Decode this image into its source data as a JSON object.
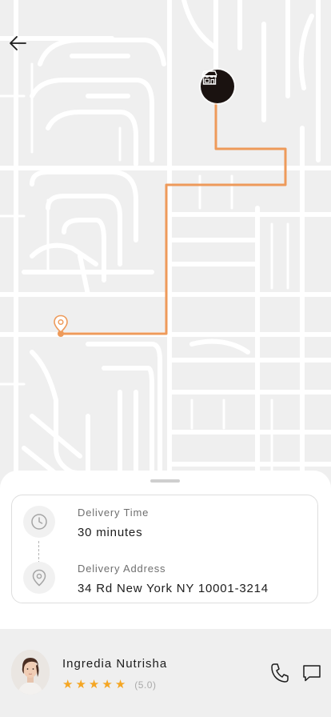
{
  "theme": {
    "route_color": "#ee9a5a",
    "store_pin_color": "#1a1210",
    "star_color": "#f5a623"
  },
  "map": {
    "back_icon": "arrow-left-icon",
    "store_icon": "storefront-icon",
    "destination_icon": "location-pin-icon"
  },
  "delivery": {
    "time_label": "Delivery Time",
    "time_value": "30 minutes",
    "address_label": "Delivery Address",
    "address_value": "34 Rd New York NY 10001-3214",
    "time_icon": "clock-icon",
    "address_icon": "location-pin-icon"
  },
  "courier": {
    "name": "Ingredia Nutrisha",
    "stars": 5,
    "rating_text": "(5.0)",
    "call_icon": "phone-icon",
    "chat_icon": "chat-bubble-icon"
  }
}
